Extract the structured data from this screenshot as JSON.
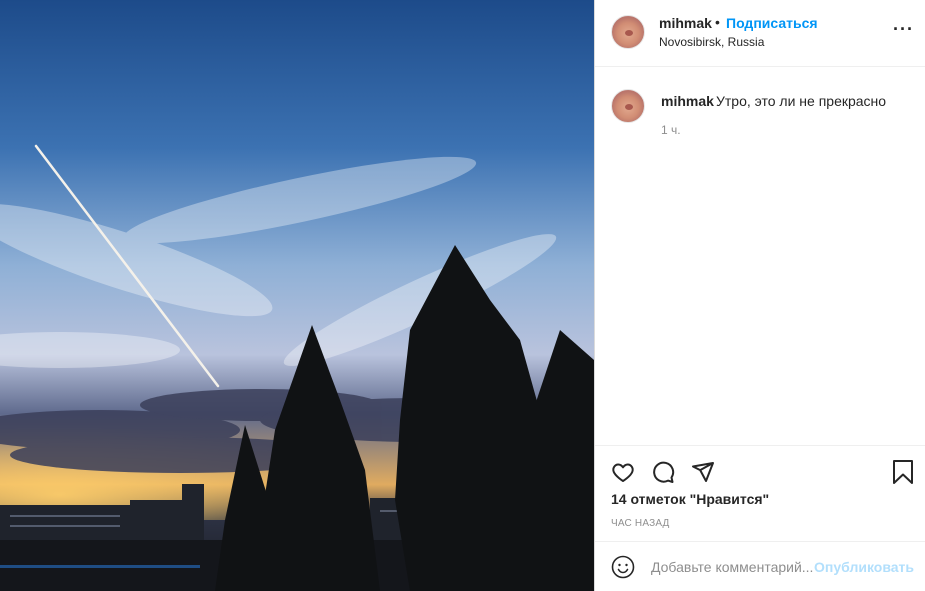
{
  "post": {
    "image_alt": "sky-photo",
    "author": "mihmak",
    "separator": "•",
    "follow_label": "Подписаться",
    "location": "Novosibirsk, Russia",
    "more_icon": "more-horizontal-icon"
  },
  "caption": {
    "author": "mihmak",
    "text": "Утро, это ли не прекрасно",
    "time": "1 ч."
  },
  "actions": {
    "like_icon": "heart-icon",
    "comment_icon": "comment-icon",
    "share_icon": "send-icon",
    "save_icon": "bookmark-icon"
  },
  "likes_text": "14 отметок \"Нравится\"",
  "posted_text": "ЧАС НАЗАД",
  "composer": {
    "emoji_icon": "emoji-icon",
    "placeholder": "Добавьте комментарий...",
    "publish_label": "Опубликовать"
  },
  "colors": {
    "accent": "#0095f6",
    "publish_disabled": "#b2dffc",
    "muted": "#8e8e8e"
  }
}
